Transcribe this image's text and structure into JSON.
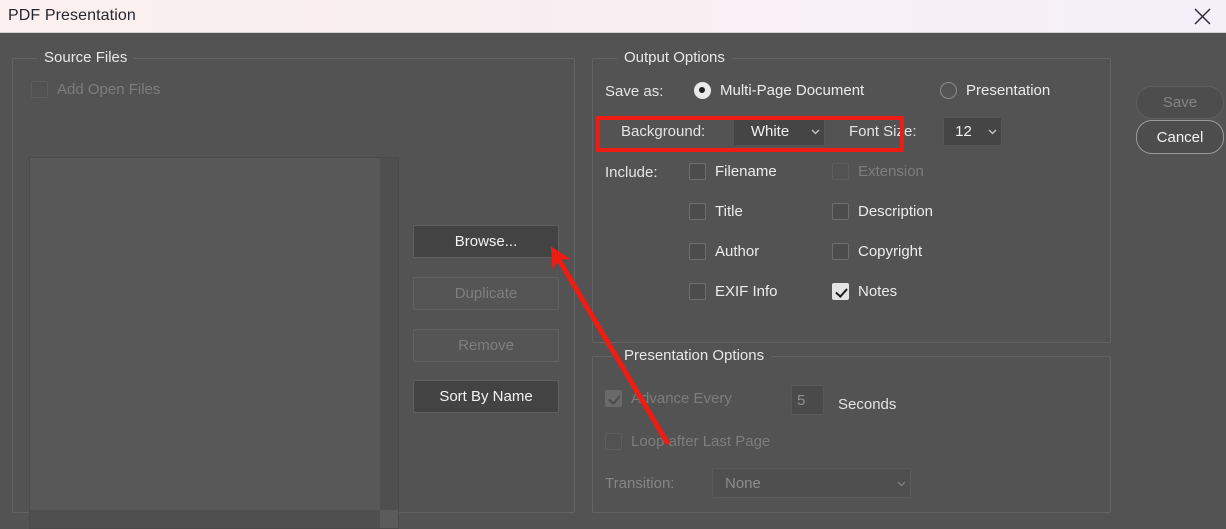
{
  "titlebar": {
    "title": "PDF Presentation",
    "close_icon": "close-icon"
  },
  "source_files": {
    "group_title": "Source Files",
    "add_open_files": {
      "label": "Add Open Files",
      "checked": false,
      "enabled": false
    },
    "file_list_items": [],
    "buttons": [
      {
        "label": "Browse...",
        "enabled": true
      },
      {
        "label": "Duplicate",
        "enabled": false
      },
      {
        "label": "Remove",
        "enabled": false
      },
      {
        "label": "Sort By Name",
        "enabled": true
      }
    ]
  },
  "output_options": {
    "group_title": "Output Options",
    "save_as_label": "Save as:",
    "save_as_options": [
      {
        "label": "Multi-Page Document",
        "selected": true
      },
      {
        "label": "Presentation",
        "selected": false
      }
    ],
    "background_label": "Background:",
    "background_value": "White",
    "font_size_label": "Font Size:",
    "font_size_value": "12",
    "include_label": "Include:",
    "include_items": [
      {
        "label": "Filename",
        "checked": false,
        "enabled": true
      },
      {
        "label": "Extension",
        "checked": false,
        "enabled": false
      },
      {
        "label": "Title",
        "checked": false,
        "enabled": true
      },
      {
        "label": "Description",
        "checked": false,
        "enabled": true
      },
      {
        "label": "Author",
        "checked": false,
        "enabled": true
      },
      {
        "label": "Copyright",
        "checked": false,
        "enabled": true
      },
      {
        "label": "EXIF Info",
        "checked": false,
        "enabled": true
      },
      {
        "label": "Notes",
        "checked": true,
        "enabled": true
      }
    ]
  },
  "presentation_options": {
    "group_title": "Presentation Options",
    "advance_every_label": "Advance Every",
    "advance_every_checked": true,
    "advance_every_value": "5",
    "seconds_label": "Seconds",
    "loop_label": "Loop after Last Page",
    "loop_checked": false,
    "transition_label": "Transition:",
    "transition_value": "None",
    "enabled": false
  },
  "action_buttons": {
    "save_label": "Save",
    "save_enabled": false,
    "cancel_label": "Cancel",
    "cancel_enabled": true
  },
  "annotations": {
    "highlight_color": "#ee1c12",
    "highlight_target": "Save as: Multi-Page Document",
    "arrow_color": "#ee1c12",
    "arrow_points_to": "Duplicate button"
  },
  "colors": {
    "dialog_bg": "#535353",
    "titlebar_bg": "#fbf0ef",
    "text": "#ececec",
    "disabled_text": "#7d7d7d",
    "accent_red": "#ee1c12"
  }
}
